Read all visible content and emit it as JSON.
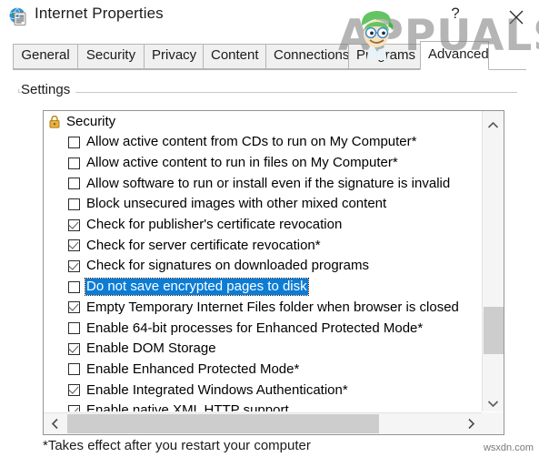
{
  "window": {
    "title": "Internet Properties",
    "icon": "internet-properties-globe-icon",
    "help_label": "?",
    "close_label": "✕"
  },
  "tabs": [
    {
      "label": "General",
      "selected": false
    },
    {
      "label": "Security",
      "selected": false
    },
    {
      "label": "Privacy",
      "selected": false
    },
    {
      "label": "Content",
      "selected": false
    },
    {
      "label": "Connections",
      "selected": false
    },
    {
      "label": "Programs",
      "selected": false
    },
    {
      "label": "Advanced",
      "selected": true
    }
  ],
  "group": {
    "label": "Settings"
  },
  "settings_list": {
    "category": {
      "label": "Security",
      "icon": "padlock-icon"
    },
    "items": [
      {
        "label": "Allow active content from CDs to run on My Computer*",
        "checked": false,
        "selected": false
      },
      {
        "label": "Allow active content to run in files on My Computer*",
        "checked": false,
        "selected": false
      },
      {
        "label": "Allow software to run or install even if the signature is invalid",
        "checked": false,
        "selected": false
      },
      {
        "label": "Block unsecured images with other mixed content",
        "checked": false,
        "selected": false
      },
      {
        "label": "Check for publisher's certificate revocation",
        "checked": true,
        "selected": false
      },
      {
        "label": "Check for server certificate revocation*",
        "checked": true,
        "selected": false
      },
      {
        "label": "Check for signatures on downloaded programs",
        "checked": true,
        "selected": false
      },
      {
        "label": "Do not save encrypted pages to disk",
        "checked": false,
        "selected": true
      },
      {
        "label": "Empty Temporary Internet Files folder when browser is closed",
        "checked": true,
        "selected": false
      },
      {
        "label": "Enable 64-bit processes for Enhanced Protected Mode*",
        "checked": false,
        "selected": false
      },
      {
        "label": "Enable DOM Storage",
        "checked": true,
        "selected": false
      },
      {
        "label": "Enable Enhanced Protected Mode*",
        "checked": false,
        "selected": false
      },
      {
        "label": "Enable Integrated Windows Authentication*",
        "checked": true,
        "selected": false
      },
      {
        "label": "Enable native XML HTTP support",
        "checked": true,
        "selected": false
      }
    ]
  },
  "scrollbars": {
    "vertical": {
      "up_icon": "chevron-up-icon",
      "down_icon": "chevron-down-icon"
    },
    "horizontal": {
      "left_icon": "chevron-left-icon",
      "right_icon": "chevron-right-icon"
    }
  },
  "footer": {
    "note": "*Takes effect after you restart your computer",
    "site_watermark": "wsxdn.com"
  },
  "brand_watermark": {
    "text": "APPUALS"
  },
  "colors": {
    "selection_blue": "#0c7cd5",
    "scrollbar_thumb": "#cdcdcd",
    "border_gray": "#949494",
    "lock_gold": "#e0a32e"
  }
}
